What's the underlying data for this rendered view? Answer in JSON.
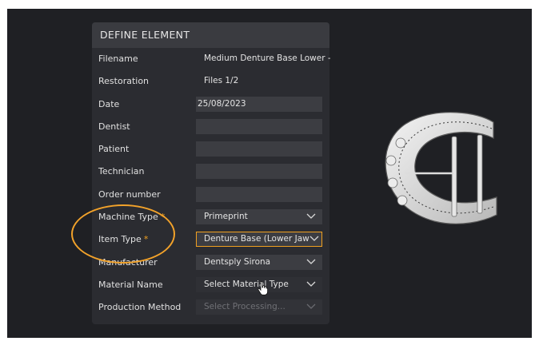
{
  "panel": {
    "title": "DEFINE ELEMENT",
    "rows": [
      {
        "label": "Filename",
        "value": "Medium Denture Base Lower -"
      },
      {
        "label": "Restoration",
        "value": "Files 1/2"
      },
      {
        "label": "Date",
        "value": "25/08/2023"
      },
      {
        "label": "Dentist",
        "value": ""
      },
      {
        "label": "Patient",
        "value": ""
      },
      {
        "label": "Technician",
        "value": ""
      },
      {
        "label": "Order number",
        "value": ""
      },
      {
        "label": "Machine Type",
        "required": "*",
        "value": "Primeprint"
      },
      {
        "label": "Item Type",
        "required": "*",
        "value": "Denture Base (Lower Jaw"
      },
      {
        "label": "Manufacturer",
        "value": "Dentsply Sirona"
      },
      {
        "label": "Material Name",
        "value": "Select Material Type"
      },
      {
        "label": "Production Method",
        "value": "Select Processing..."
      }
    ]
  },
  "colors": {
    "accent": "#f0a020",
    "background": "#1f2024",
    "panel": "#2b2c31"
  },
  "icons": {
    "dropdown": "chevron-down-icon",
    "cursor": "hand-pointer-icon",
    "model": "denture-model"
  }
}
